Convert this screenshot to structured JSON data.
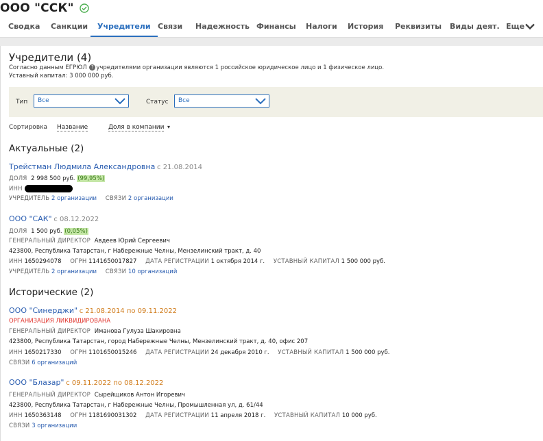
{
  "header": {
    "company": "ООО \"ССК\""
  },
  "tabs": [
    {
      "label": "Сводка"
    },
    {
      "label": "Санкции"
    },
    {
      "label": "Учредители"
    },
    {
      "label": "Связи"
    },
    {
      "label": "Надежность"
    },
    {
      "label": "Финансы"
    },
    {
      "label": "Налоги"
    },
    {
      "label": "История"
    },
    {
      "label": "Реквизиты"
    },
    {
      "label": "Виды деят."
    },
    {
      "label": "Еще"
    }
  ],
  "section": {
    "title": "Учредители (4)",
    "desc_before": "Согласно данным ЕГРЮЛ",
    "desc_after": "учредителями организации являются 1 российское юридическое лицо и 1 физическое лицо.",
    "capital": "Уставный капитал: 3 000 000 руб."
  },
  "filters": {
    "type_label": "Тип",
    "type_value": "Все",
    "status_label": "Статус",
    "status_value": "Все"
  },
  "sort": {
    "label": "Сортировка",
    "by_name": "Название",
    "by_share": "Доля в компании",
    "arrow": "▾"
  },
  "labels": {
    "share": "ДОЛЯ",
    "inn": "ИНН",
    "founder": "УЧРЕДИТЕЛЬ",
    "links": "СВЯЗИ",
    "director": "ГЕНЕРАЛЬНЫЙ ДИРЕКТОР",
    "ogrn": "ОГРН",
    "reg_date": "ДАТА РЕГИСТРАЦИИ",
    "capital": "УСТАВНЫЙ КАПИТАЛ"
  },
  "actual": {
    "title": "Актуальные (2)",
    "person": {
      "name": "Трейстман Людмила Александровна",
      "since": "с 21.08.2014",
      "share": "2 998 500 руб.",
      "share_pct": "(99,95%)",
      "founder_link": "2 организации",
      "links_link": "2 организации"
    },
    "org": {
      "name": "ООО \"САК\"",
      "since": "с 08.12.2022",
      "share": "1 500 руб.",
      "share_pct": "(0,05%)",
      "director": "Авдеев Юрий Сергеевич",
      "address": "423800, Республика Татарстан, г Набережные Челны, Мензелинский тракт, д. 40",
      "inn": "1650294078",
      "ogrn": "1141650017827",
      "reg_date": "1 октября 2014 г.",
      "capital": "1 500 000 руб.",
      "founder_link": "2 организации",
      "links_link": "10 организаций"
    }
  },
  "historic": {
    "title": "Исторические (2)",
    "org1": {
      "name": "ООО \"Синерджи\"",
      "period": "с 21.08.2014 по 09.11.2022",
      "status": "ОРГАНИЗАЦИЯ ЛИКВИДИРОВАНА",
      "director": "Иманова Гулуза Шакировна",
      "address": "423800, Республика Татарстан, город Набережные Челны, Мензелинский тракт, д. 40, офис 207",
      "inn": "1650217330",
      "ogrn": "1101650015246",
      "reg_date": "24 декабря 2010 г.",
      "capital": "1 500 000 руб.",
      "links_link": "6 организаций"
    },
    "org2": {
      "name": "ООО \"Блазар\"",
      "period": "с 09.11.2022 по 08.12.2022",
      "director": "Сырейщиков Антон Игоревич",
      "address": "423800, Республика Татарстан, г Набережные Челны, Промышленная ул, д. 61/44",
      "inn": "1650363148",
      "ogrn": "1181690031302",
      "reg_date": "11 апреля 2018 г.",
      "capital": "10 000 руб.",
      "links_link": "3 организации"
    }
  },
  "colors": {
    "accent": "#2a6ebd",
    "link": "#2a5db0",
    "orange": "#d07b1a",
    "red": "#e0312a",
    "filter_bg": "#f1f0e6"
  }
}
